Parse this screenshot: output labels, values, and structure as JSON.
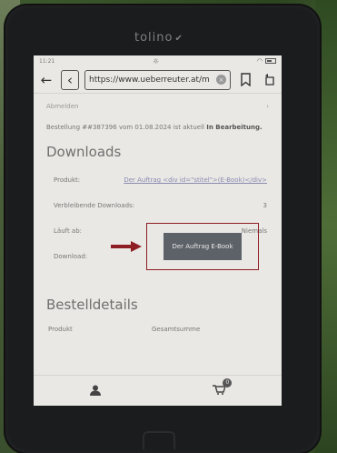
{
  "device": {
    "brand": "tolino"
  },
  "status": {
    "time": "11:21"
  },
  "browser": {
    "url": "https://www.ueberreuter.at/m"
  },
  "page": {
    "logout": "Abmelden",
    "order": {
      "prefix": "Bestellung",
      "number": "##387396",
      "date_text": "vom 01.08.2024 ist aktuell",
      "state": "In Bearbeitung."
    },
    "downloads_title": "Downloads",
    "rows": {
      "product_label": "Produkt:",
      "product_value": "Der Auftrag <div id=\"stitel\">(E-Book)</div>",
      "remaining_label": "Verbleibende Downloads:",
      "remaining_value": "3",
      "expires_label": "Läuft ab:",
      "expires_value": "Niemals",
      "download_label": "Download:"
    },
    "download_button": "Der Auftrag E-Book",
    "details_title": "Bestelldetails",
    "details_columns": [
      "Produkt",
      "Gesamtsumme"
    ]
  },
  "bottom": {
    "cart_count": "0"
  },
  "colors": {
    "highlight": "#8e1d24",
    "button": "#5d6268"
  }
}
